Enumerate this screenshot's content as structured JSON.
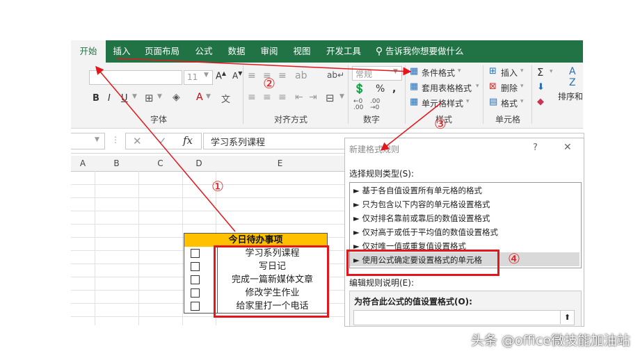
{
  "ribbon": {
    "tabs": [
      "开始",
      "插入",
      "页面布局",
      "公式",
      "数据",
      "审阅",
      "视图",
      "开发工具"
    ],
    "tell_me": "告诉我你想要做什么",
    "font_size": "11",
    "number_format": "常规",
    "groups": {
      "font": "字体",
      "alignment": "对齐方式",
      "number": "数字",
      "styles": "样式",
      "cells": "单元格"
    },
    "styles_buttons": {
      "conditional": "条件格式",
      "table_format": "套用表格格式",
      "cell_styles": "单元格样式"
    },
    "cells_buttons": {
      "insert": "插入",
      "delete": "删除",
      "format": "格式"
    },
    "sort_label": "排序和",
    "bold": "B",
    "italic": "I",
    "underline": "U",
    "percent": "%",
    "sigma": "Σ"
  },
  "formula_bar": {
    "fx": "fx",
    "content": "学习系列课程"
  },
  "grid": {
    "columns": [
      "A",
      "B",
      "C",
      "D",
      "E"
    ]
  },
  "todo": {
    "title": "今日待办事项",
    "items": [
      "学习系列课程",
      "写日记",
      "完成一篇新媒体文章",
      "修改学生作业",
      "给家里打一个电话"
    ]
  },
  "dialog": {
    "title": "新建格式规则",
    "help": "?",
    "close": "✕",
    "select_type_label": "选择规则类型(S):",
    "rules": [
      "► 基于各自值设置所有单元格的格式",
      "► 只为包含以下内容的单元格设置格式",
      "► 仅对排名靠前或靠后的数值设置格式",
      "► 仅对高于或低于平均值的数值设置格式",
      "► 仅对唯一值或重复值设置格式",
      "► 使用公式确定要设置格式的单元格"
    ],
    "edit_desc_label": "编辑规则说明(E):",
    "formula_label": "为符合此公式的值设置格式(O):",
    "collapse_icon": "⬆"
  },
  "annotations": [
    "①",
    "②",
    "③",
    "④"
  ],
  "watermark": "头条 @office微技能加油站",
  "colors": {
    "excel_green": "#217346",
    "highlight_red": "#e3161b",
    "todo_header": "#ffc000"
  }
}
